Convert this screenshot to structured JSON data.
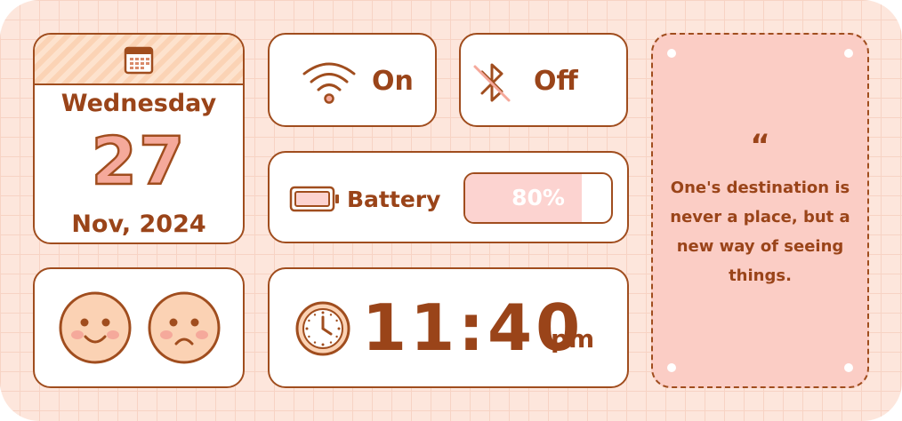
{
  "calendar": {
    "weekday": "Wednesday",
    "day": "27",
    "month_year": "Nov, 2024",
    "icon": "calendar-icon"
  },
  "wifi": {
    "status": "On",
    "icon": "wifi-icon"
  },
  "bluetooth": {
    "status": "Off",
    "icon": "bluetooth-off-icon"
  },
  "battery": {
    "label": "Battery",
    "percent_text": "80%",
    "level": 0.8,
    "icon": "battery-icon"
  },
  "moods": [
    {
      "icon": "happy-face-icon"
    },
    {
      "icon": "sad-face-icon"
    }
  ],
  "clock": {
    "time": "11:40",
    "period": "pm",
    "icon": "clock-icon"
  },
  "quote": {
    "mark": "“",
    "text": "One's destination is never a place, but a new way of seeing things."
  },
  "colors": {
    "background": "#fde6dc",
    "outline": "#a04d1e",
    "text": "#9a4419",
    "accent_pink": "#f5a99b",
    "quote_bg": "#fbcdc5",
    "battery_fill": "#fcd3d0"
  }
}
